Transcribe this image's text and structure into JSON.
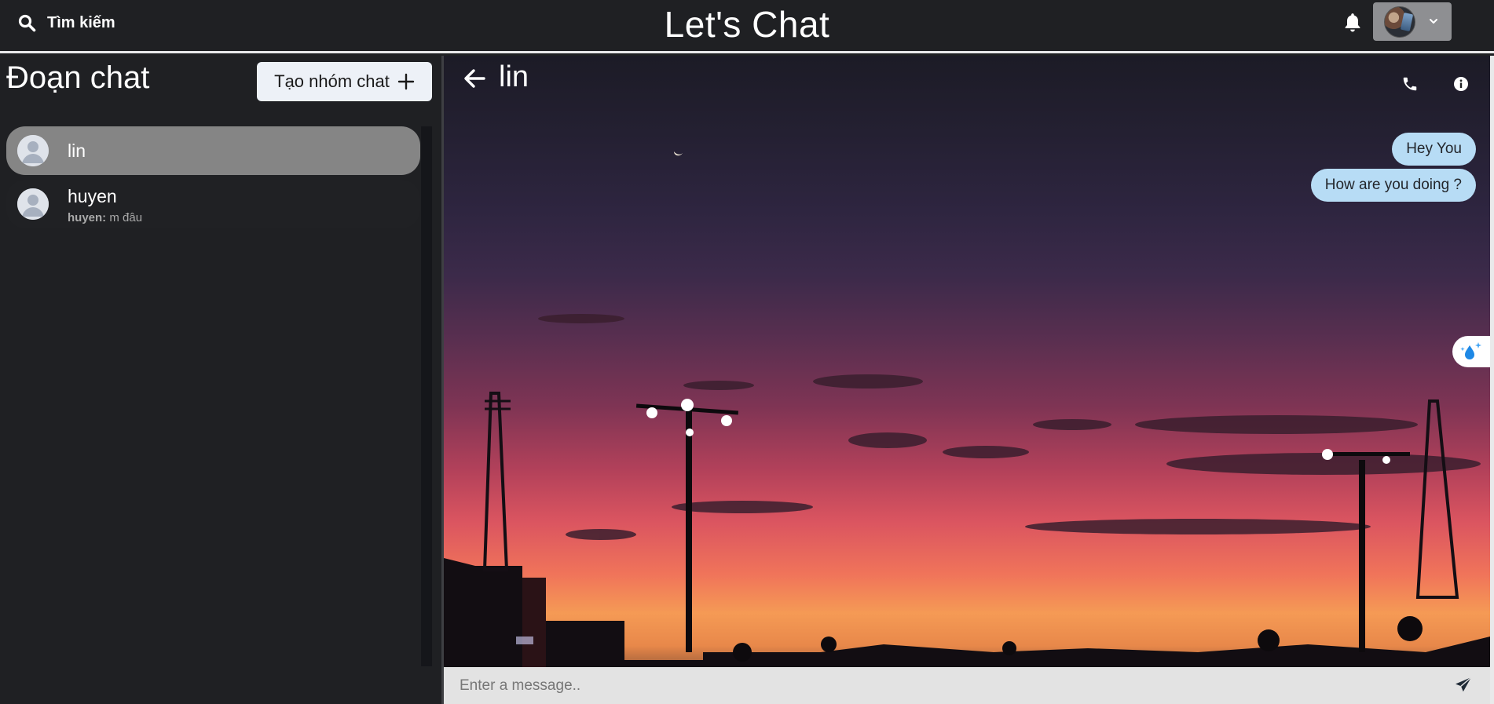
{
  "header": {
    "search_label": "Tìm kiếm",
    "app_title": "Let's Chat",
    "icons": {
      "search": "search-icon",
      "bell": "bell-icon",
      "chevron": "chevron-down-icon"
    }
  },
  "sidebar": {
    "title": "Đoạn chat",
    "create_group_label": "Tạo nhóm chat",
    "chats": [
      {
        "name": "lin",
        "active": true
      },
      {
        "name": "huyen",
        "preview_sender": "huyen:",
        "preview_text": "m đâu"
      }
    ]
  },
  "conversation": {
    "name": "lin",
    "messages": [
      {
        "text": "Hey You"
      },
      {
        "text": "How are you doing ?"
      }
    ],
    "composer_placeholder": "Enter a message.."
  },
  "colors": {
    "background": "#1f2023",
    "bubble": "#b7dcf5",
    "active_chat": "#858585",
    "button": "#edf1f7",
    "composer": "#e3e3e3"
  }
}
